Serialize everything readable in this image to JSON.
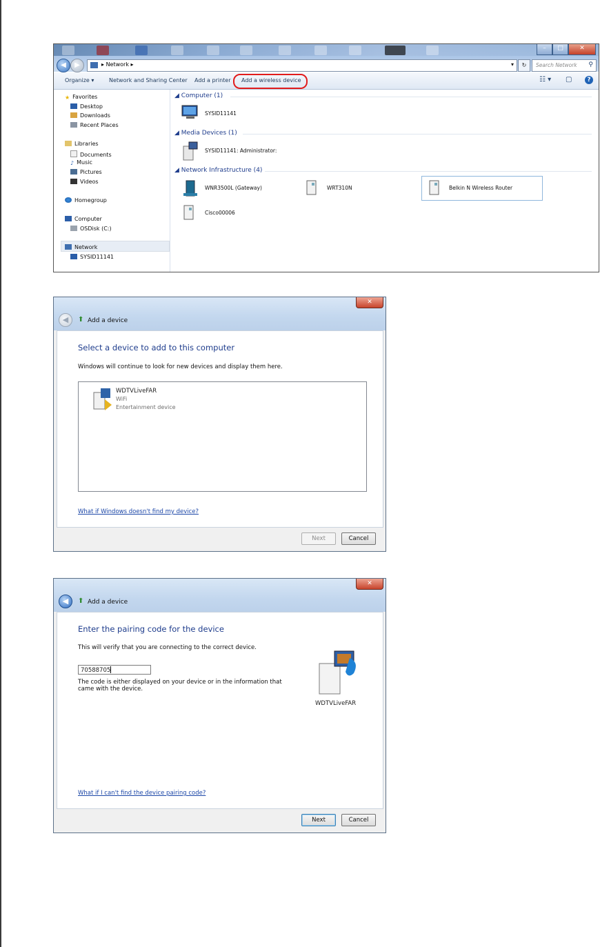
{
  "explorer": {
    "address": "Network",
    "search_placeholder": "Search Network",
    "commands": {
      "organize": "Organize ▾",
      "sharing_center": "Network and Sharing Center",
      "add_printer": "Add a printer",
      "add_wireless": "Add a wireless device"
    },
    "nav": {
      "favorites": "Favorites",
      "desktop": "Desktop",
      "downloads": "Downloads",
      "recent": "Recent Places",
      "libraries": "Libraries",
      "documents": "Documents",
      "music": "Music",
      "pictures": "Pictures",
      "videos": "Videos",
      "homegroup": "Homegroup",
      "computer": "Computer",
      "osdisk": "OSDisk (C:)",
      "network": "Network",
      "sysid": "SYSID11141"
    },
    "groups": {
      "computer": "Computer (1)",
      "media": "Media Devices (1)",
      "infra": "Network Infrastructure (4)"
    },
    "devices": {
      "computer_item": "SYSID11141",
      "media_item": "SYSID11141: Administrator:",
      "gateway": "WNR3500L (Gateway)",
      "wrt": "WRT310N",
      "belkin": "Belkin N Wireless Router",
      "cisco": "Cisco00006"
    },
    "highlight_color": "#e21b1b"
  },
  "dialog1": {
    "title": "Add a device",
    "heading": "Select a device to add to this computer",
    "subtext": "Windows will continue to look for new devices and display them here.",
    "device": {
      "name": "WDTVLiveFAR",
      "type": "WiFi",
      "category": "Entertainment device"
    },
    "help_link": "What if Windows doesn't find my device?",
    "next": "Next",
    "cancel": "Cancel"
  },
  "dialog2": {
    "title": "Add a device",
    "heading": "Enter the pairing code for the device",
    "subtext": "This will verify that you are connecting to the correct device.",
    "code": "70588705",
    "hint_line1": "The code is either displayed on your device or in the information that",
    "hint_line2": "came with the device.",
    "device_name": "WDTVLiveFAR",
    "help_link": "What if I can't find the device pairing code?",
    "next": "Next",
    "cancel": "Cancel"
  }
}
